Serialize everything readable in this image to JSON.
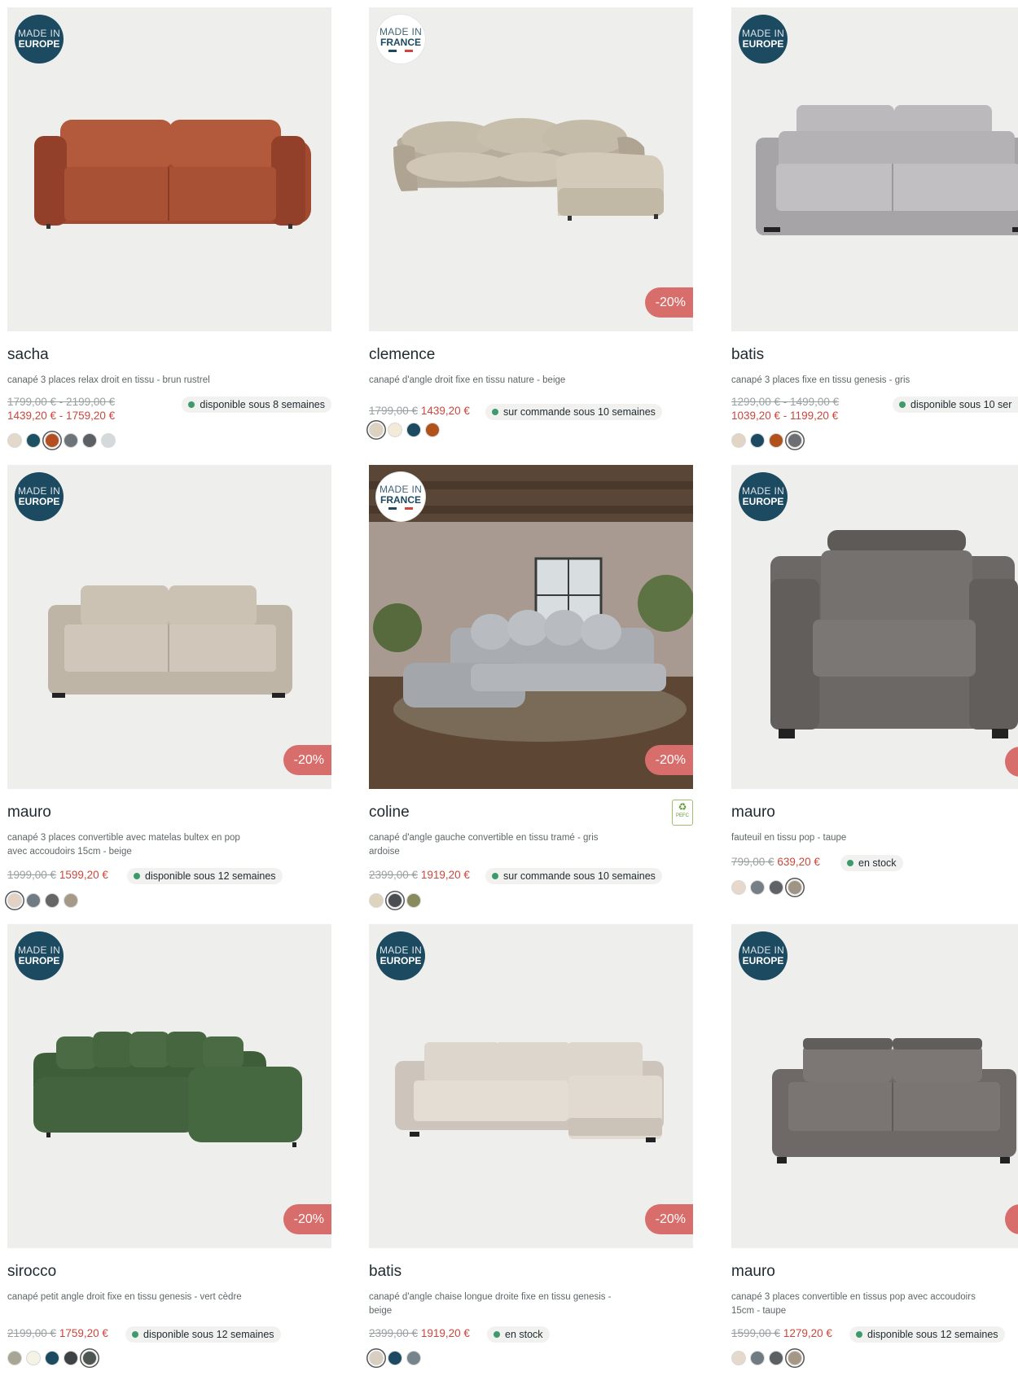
{
  "products": [
    {
      "name": "sacha",
      "desc": "canapé 3 places relax droit en tissu - brun rustrel",
      "origin_l1": "MADE IN",
      "origin_l2": "EUROPE",
      "old": "1799,00 € - 2199,00 €",
      "new": "1439,20 € - 1759,20 €",
      "stock": "disponible sous 8 semaines",
      "discount": ""
    },
    {
      "name": "clemence",
      "desc": "canapé d'angle droit fixe en tissu nature - beige",
      "origin_l1": "MADE IN",
      "origin_l2": "FRANCE",
      "old": "1799,00 €",
      "new": "1439,20 €",
      "stock": "sur commande sous 10 semaines",
      "discount": "-20%"
    },
    {
      "name": "batis",
      "desc": "canapé 3 places fixe en tissu genesis - gris",
      "origin_l1": "MADE IN",
      "origin_l2": "EUROPE",
      "old": "1299,00 € - 1499,00 €",
      "new": "1039,20 € - 1199,20 €",
      "stock": "disponible sous 10 ser",
      "discount": ""
    },
    {
      "name": "mauro",
      "desc": "canapé 3 places convertible avec matelas bultex en pop avec accoudoirs 15cm - beige",
      "origin_l1": "MADE IN",
      "origin_l2": "EUROPE",
      "old": "1999,00 €",
      "new": "1599,20 €",
      "stock": "disponible sous 12 semaines",
      "discount": "-20%"
    },
    {
      "name": "coline",
      "desc": "canapé d'angle gauche convertible en tissu tramé - gris ardoise",
      "origin_l1": "MADE IN",
      "origin_l2": "FRANCE",
      "old": "2399,00 €",
      "new": "1919,20 €",
      "stock": "sur commande sous 10 semaines",
      "discount": "-20%",
      "label": "PEFC"
    },
    {
      "name": "mauro",
      "desc": "fauteuil en tissu pop - taupe",
      "origin_l1": "MADE IN",
      "origin_l2": "EUROPE",
      "old": "799,00 €",
      "new": "639,20 €",
      "stock": "en stock",
      "discount": ""
    },
    {
      "name": "sirocco",
      "desc": "canapé petit angle droit fixe en tissu genesis - vert cèdre",
      "origin_l1": "MADE IN",
      "origin_l2": "EUROPE",
      "old": "2199,00 €",
      "new": "1759,20 €",
      "stock": "disponible sous 12 semaines",
      "discount": "-20%"
    },
    {
      "name": "batis",
      "desc": "canapé d'angle chaise longue droite fixe en tissu genesis - beige",
      "origin_l1": "MADE IN",
      "origin_l2": "EUROPE",
      "old": "2399,00 €",
      "new": "1919,20 €",
      "stock": "en stock",
      "discount": "-20%"
    },
    {
      "name": "mauro",
      "desc": "canapé 3 places convertible en tissus pop avec accoudoirs 15cm - taupe",
      "origin_l1": "MADE IN",
      "origin_l2": "EUROPE",
      "old": "1599,00 €",
      "new": "1279,20 €",
      "stock": "disponible sous 12 semaines",
      "discount": ""
    }
  ],
  "swatch_colors": [
    [
      "#e3d8c9",
      "#1b5162",
      "#b44f22",
      "#6d757a",
      "#5b6064",
      "#d4dadc"
    ],
    [
      "#ddd2bf",
      "#f3ead7",
      "#1b4a62",
      "#b1521c"
    ],
    [
      "#e3d5c5",
      "#1b4a62",
      "#b1521c",
      "#6c7074"
    ],
    [
      "#e1d2c5",
      "#717b83",
      "#666",
      "#a59a8a"
    ],
    [
      "#ded3bc",
      "#4a4d52",
      "#8a8a5f"
    ],
    [
      "#e7d8cd",
      "#767f86",
      "#5f6367",
      "#a09585"
    ],
    [
      "#a8a595",
      "#f5f2e6",
      "#1b4a62",
      "#3f4244",
      "#4d5650"
    ],
    [
      "#d9cfc0",
      "#1b4a62",
      "#76858c"
    ],
    [
      "#e4d9cc",
      "#6f7a81",
      "#5b6064",
      "#a69886"
    ]
  ]
}
